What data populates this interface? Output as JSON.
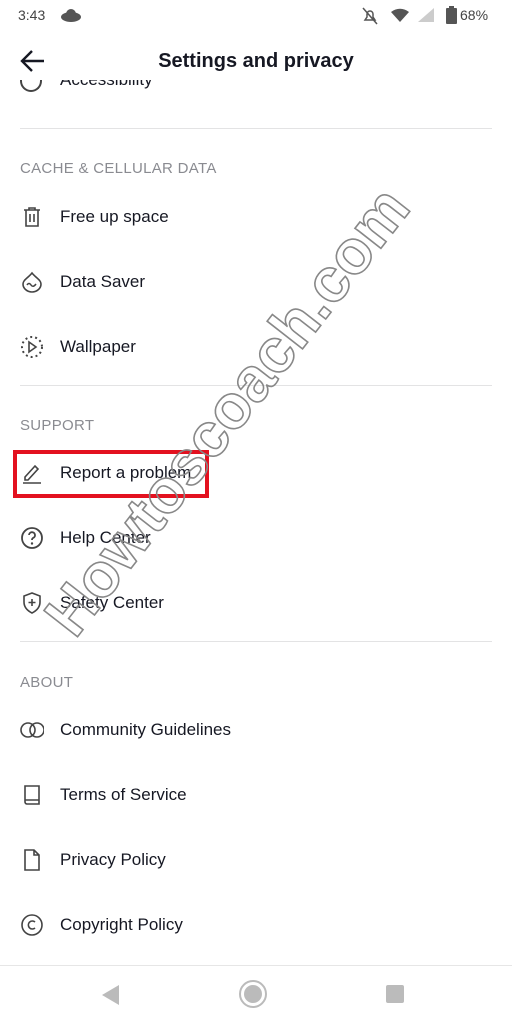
{
  "status_bar": {
    "time": "3:43",
    "battery": "68%"
  },
  "header": {
    "title": "Settings and privacy"
  },
  "clipped_item": {
    "label": "Accessibility"
  },
  "sections": [
    {
      "title": "CACHE & CELLULAR DATA",
      "items": [
        {
          "label": "Free up space",
          "icon": "trash-icon"
        },
        {
          "label": "Data Saver",
          "icon": "data-saver-icon"
        },
        {
          "label": "Wallpaper",
          "icon": "wallpaper-icon"
        }
      ]
    },
    {
      "title": "SUPPORT",
      "items": [
        {
          "label": "Report a problem",
          "icon": "pencil-icon"
        },
        {
          "label": "Help Center",
          "icon": "question-icon"
        },
        {
          "label": "Safety Center",
          "icon": "shield-icon"
        }
      ]
    },
    {
      "title": "ABOUT",
      "items": [
        {
          "label": "Community Guidelines",
          "icon": "rings-icon"
        },
        {
          "label": "Terms of Service",
          "icon": "book-icon"
        },
        {
          "label": "Privacy Policy",
          "icon": "document-icon"
        },
        {
          "label": "Copyright Policy",
          "icon": "copyright-icon"
        }
      ]
    }
  ],
  "highlight_color": "#e3111f",
  "watermark": "Howtoscoach.com"
}
